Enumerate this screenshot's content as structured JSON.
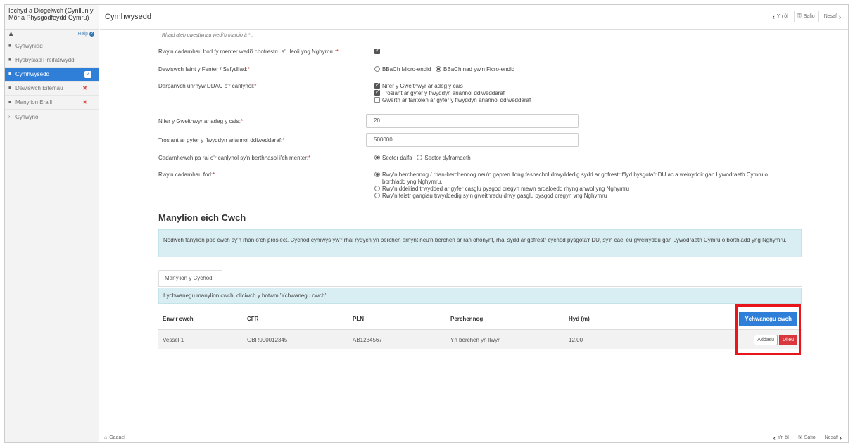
{
  "app": {
    "title": "Iechyd a Diogelwch (Cynllun y Môr a Physgodfeydd Cymru)"
  },
  "sidebar": {
    "help_label": "Help",
    "items": [
      {
        "label": "Cyflwyniad",
        "icon": "document-icon",
        "status": ""
      },
      {
        "label": "Hysbysiad Preifatrwydd",
        "icon": "document-icon",
        "status": ""
      },
      {
        "label": "Cymhwysedd",
        "icon": "document-icon",
        "status": "complete"
      },
      {
        "label": "Dewiswch Eitemau",
        "icon": "document-icon",
        "status": "error",
        "status_mark": "✖"
      },
      {
        "label": "Manylion Eraill",
        "icon": "document-icon",
        "status": "error",
        "status_mark": "✖"
      },
      {
        "label": "Cyflwyno",
        "icon": "chevron-right-icon",
        "status": ""
      }
    ]
  },
  "header": {
    "page_title": "Cymhwysedd",
    "back_label": "Yn ôl",
    "save_label": "Safio",
    "next_label": "Nesaf"
  },
  "form": {
    "required_note": "Rhaid ateb cwestiynau wedi'u marcio â * .",
    "q1": {
      "label": "Rwy'n cadarnhau bod fy menter wedi'i chofrestru a'i lleoli yng Nghymru:",
      "checked": true
    },
    "q2": {
      "label": "Dewiswch faint y Fenter / Sefydliad:",
      "options": [
        "BBaCh Micro-endid",
        "BBaCh nad yw'n Ficro-endid"
      ],
      "selected": 1
    },
    "q3": {
      "label": "Darparwch unrhyw DDAU o'r canlynol:",
      "options": [
        {
          "label": "Nifer y Gweithwyr ar adeg y cais",
          "checked": true
        },
        {
          "label": "Trosiant ar gyfer y flwyddyn ariannol ddiweddaraf",
          "checked": true
        },
        {
          "label": "Gwerth ar fantolen ar gyfer y flwyddyn ariannol ddiweddaraf",
          "checked": false
        }
      ]
    },
    "q4": {
      "label": "Nifer y Gweithwyr ar adeg y cais:",
      "value": "20"
    },
    "q5": {
      "label": "Trosiant ar gyfer y flwyddyn ariannol ddiweddaraf:",
      "value": "500000"
    },
    "q6": {
      "label": "Cadarnhewch pa rai o'r canlynol sy'n berthnasol i'ch menter:",
      "options": [
        "Sector dalfa",
        "Sector dyframaeth"
      ],
      "selected": 0
    },
    "q7": {
      "label": "Rwy'n cadarnhau fod:",
      "options": [
        "Rwy'n berchennog / rhan-berchennog neu'n gapten llong fasnachol drwyddedig sydd ar gofrestr fflyd bysgota'r DU ac a weinyddir gan Lywodraeth Cymru o",
        "borthladd yng Nghymru.",
        "Rwy'n ddeiliad trwydded ar gyfer casglu pysgod cregyn mewn ardaloedd rhynglanwol yng Nghymru",
        "Rwy'n feistr gangiau trwyddedig sy'n gweithredu drwy gasglu pysgod cregyn yng Nghymru"
      ],
      "selected": 0
    }
  },
  "boats": {
    "section_title": "Manylion eich Cwch",
    "info_text": "Nodwch fanylion pob cwch sy'n rhan o'ch prosiect. Cychod cymwys yw'r rhai rydych yn berchen arnynt neu'n berchen ar ran ohonynt, rhai sydd ar gofrestr cychod pysgota'r DU, sy'n cael eu gweinyddu gan Lywodraeth Cymru o borthladd yng Nghymru.",
    "tab_label": "Manylion y Cychod",
    "hint_text": "I ychwanegu manylion cwch, cliciwch y botwm 'Ychwanegu cwch'.",
    "columns": [
      "Enw'r cwch",
      "CFR",
      "PLN",
      "Perchennog",
      "Hyd (m)"
    ],
    "add_label": "Ychwanegu cwch",
    "edit_label": "Addasu",
    "delete_label": "Dileu",
    "rows": [
      {
        "name": "Vessel 1",
        "cfr": "GBR000012345",
        "pln": "AB1234567",
        "owner": "Yn berchen yn llwyr",
        "length": "12.00"
      }
    ]
  },
  "footer": {
    "leave_label": "Gadael"
  },
  "colors": {
    "accent": "#2f7ed8",
    "highlight": "#e8161b",
    "danger": "#d9363e",
    "info_bg": "#d9eef2"
  }
}
